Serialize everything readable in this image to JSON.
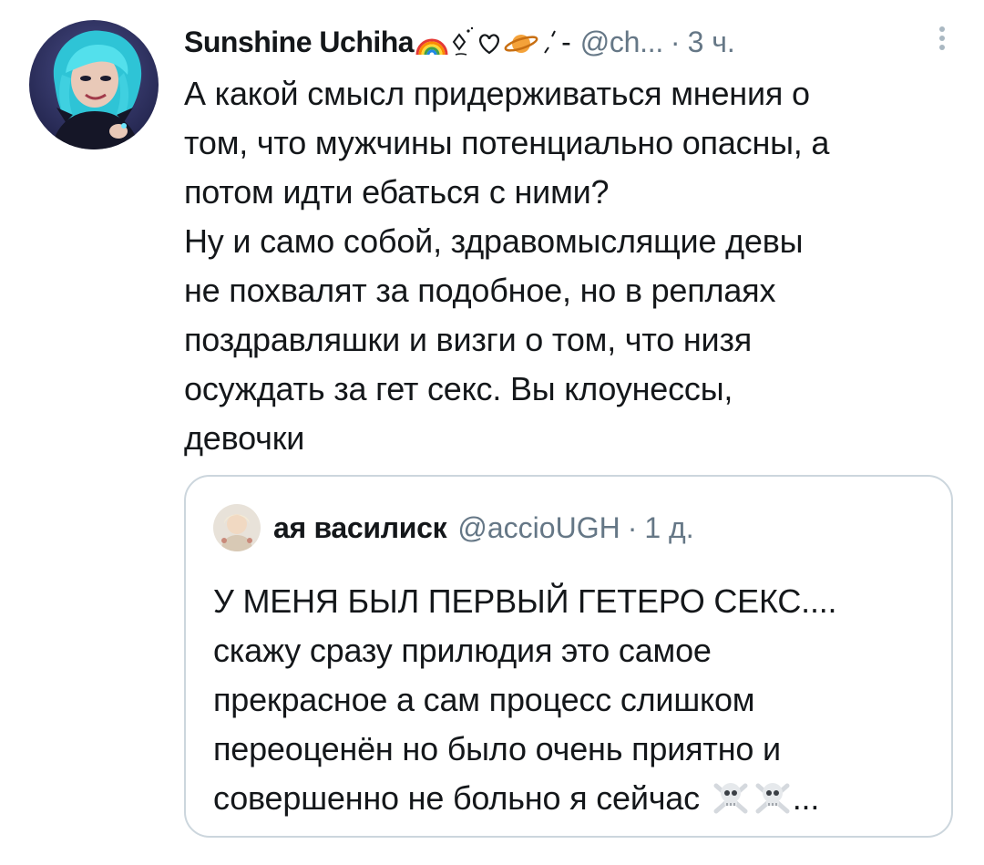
{
  "tweet": {
    "author": {
      "display_name": "Sunshine Uchiha",
      "name_emoji_icons": [
        "rainbow-icon",
        "sparkle-icon",
        "heart-icon",
        "planet-icon",
        "sparkle-icon"
      ],
      "name_emoji_tail": "-",
      "handle": "@ch...",
      "separator": "·",
      "time": "3 ч."
    },
    "text_lines": [
      "А какой смысл придерживаться мнения о",
      "том, что мужчины потенциально опасны, а",
      "потом идти ебаться с ними?",
      "Ну и само собой, здравомыслящие девы",
      "не похвалят за подобное, но в реплаях",
      "поздравляшки и визги о том, что низя",
      "осуждать за гет секс. Вы клоунессы,",
      "девочки"
    ],
    "more_icon": "more-vertical-icon"
  },
  "quoted": {
    "display_name": "ая василиск",
    "handle": "@accioUGH",
    "separator": "·",
    "time": "1 д.",
    "text_lines": [
      "У МЕНЯ БЫЛ ПЕРВЫЙ ГЕТЕРО СЕКС....",
      "скажу сразу прилюдия это самое",
      "прекрасное а сам процесс слишком",
      "переоценён но было очень приятно и",
      "совершенно не больно я сейчас"
    ],
    "trailing_emoji_icons": [
      "skull-crossbones-icon",
      "skull-crossbones-icon"
    ],
    "ellipsis": "..."
  },
  "colors": {
    "text": "#14171a",
    "secondary": "#657786",
    "border": "#ccd6dd",
    "avatar_hair": "#3fd0e0"
  }
}
